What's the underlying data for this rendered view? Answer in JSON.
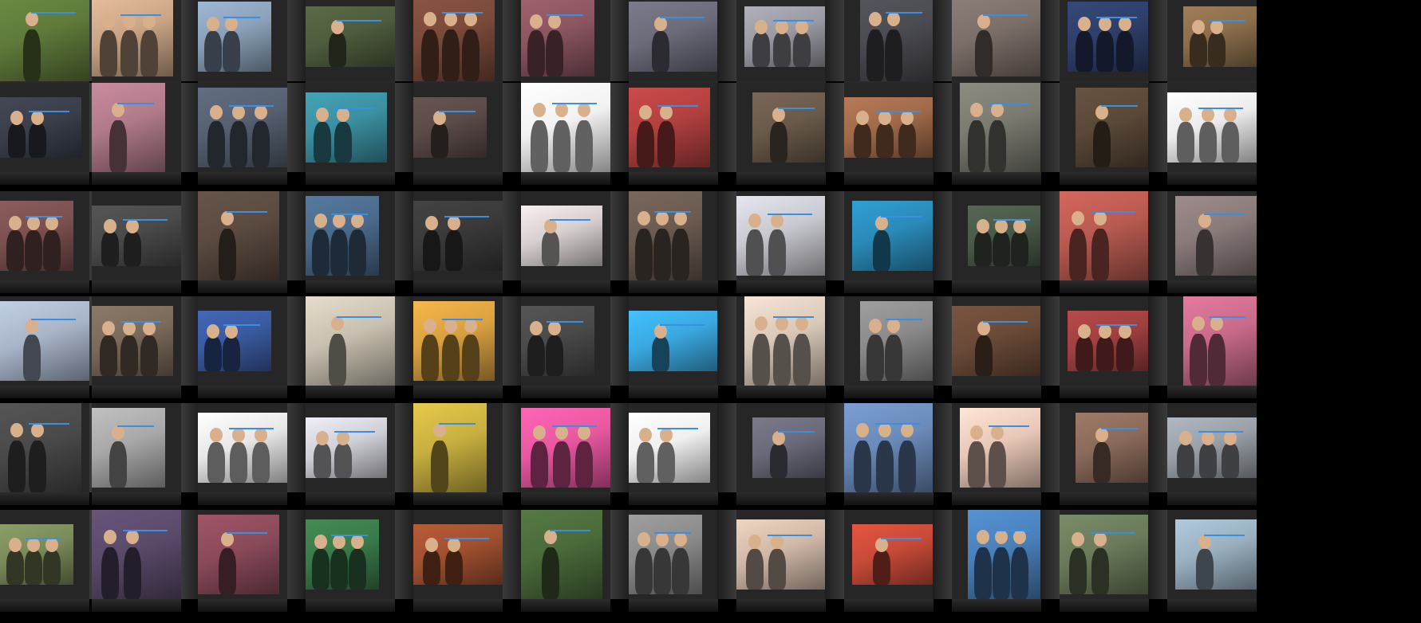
{
  "gallery": {
    "rows": 6,
    "columns": 12,
    "tile_colors": [
      [
        "#5f7a3a",
        "#c9a586",
        "#8aa0b8",
        "#4f5c3e",
        "#7a4a3a",
        "#8b5560",
        "#6b6b7a",
        "#9a9aa4",
        "#4b4b52",
        "#7b6e68",
        "#2f3f6a",
        "#8a6e4b"
      ],
      [
        "#3a3f4a",
        "#b07a8a",
        "#556070",
        "#3b8fa0",
        "#5a4a48",
        "#f2f2f2",
        "#b24040",
        "#6a5a4a",
        "#a06a4a",
        "#7a7a70",
        "#5a4838",
        "#ececec"
      ],
      [
        "#7a5050",
        "#4a4a4a",
        "#5a4a40",
        "#4a6a8a",
        "#3a3a3a",
        "#d8d0d0",
        "#6a5a50",
        "#c8c8d0",
        "#2a8ab8",
        "#4a5a48",
        "#b85a50",
        "#8a7a7a"
      ],
      [
        "#a8b4c8",
        "#7a6a5a",
        "#3a5aa0",
        "#c8c0b0",
        "#d8a040",
        "#4a4a4a",
        "#3aa8e0",
        "#d8c8b8",
        "#8a8a8a",
        "#6a4a38",
        "#a04040",
        "#c86a8a"
      ],
      [
        "#4a4a4a",
        "#a8a8a8",
        "#e8e8e8",
        "#d0d0d8",
        "#c8b040",
        "#e858a0",
        "#f0f0f0",
        "#6a6a7a",
        "#6a8ab8",
        "#e8c8b8",
        "#8a6a5a",
        "#9aa0a8"
      ],
      [
        "#7a8a5a",
        "#5a4a6a",
        "#8a4a5a",
        "#3a7a4a",
        "#a05030",
        "#4a6a3a",
        "#8a8a8a",
        "#d0b8a8",
        "#c84a38",
        "#4a80b8",
        "#6a7a5a",
        "#9ab0c0"
      ]
    ],
    "markers": "blue-detection-line"
  }
}
